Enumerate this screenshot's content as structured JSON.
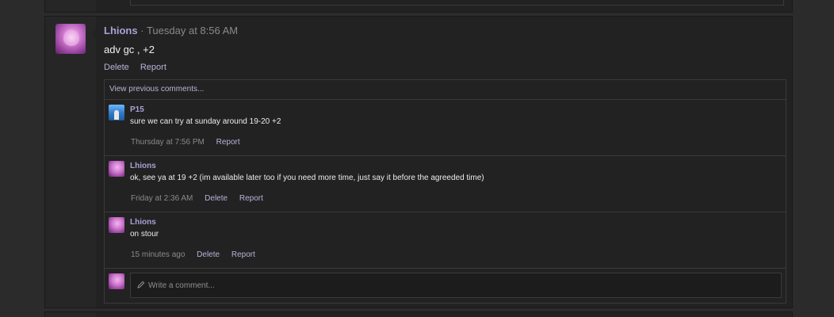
{
  "post": {
    "username": "Lhions",
    "separator": "·",
    "timestamp": "Tuesday at 8:56 AM",
    "text": "adv gc , +2",
    "actions": {
      "delete": "Delete",
      "report": "Report"
    }
  },
  "comments": {
    "view_previous": "View previous comments...",
    "items": [
      {
        "username": "P15",
        "text": "sure we can try at sunday around 19-20 +2",
        "time": "Thursday at 7:56 PM",
        "report": "Report"
      },
      {
        "username": "Lhions",
        "text": "ok, see ya at 19 +2 (im available later too if you need more time, just say it before the agreeded time)",
        "time": "Friday at 2:36 AM",
        "delete": "Delete",
        "report": "Report"
      },
      {
        "username": "Lhions",
        "text": "on stour",
        "time": "15 minutes ago",
        "delete": "Delete",
        "report": "Report"
      }
    ],
    "write_placeholder": "Write a comment..."
  },
  "icons": {
    "pencil": "pencil-icon"
  },
  "colors": {
    "username": "#a9a1d6",
    "link": "#b8b4d8",
    "background": "#2b2b2b"
  }
}
